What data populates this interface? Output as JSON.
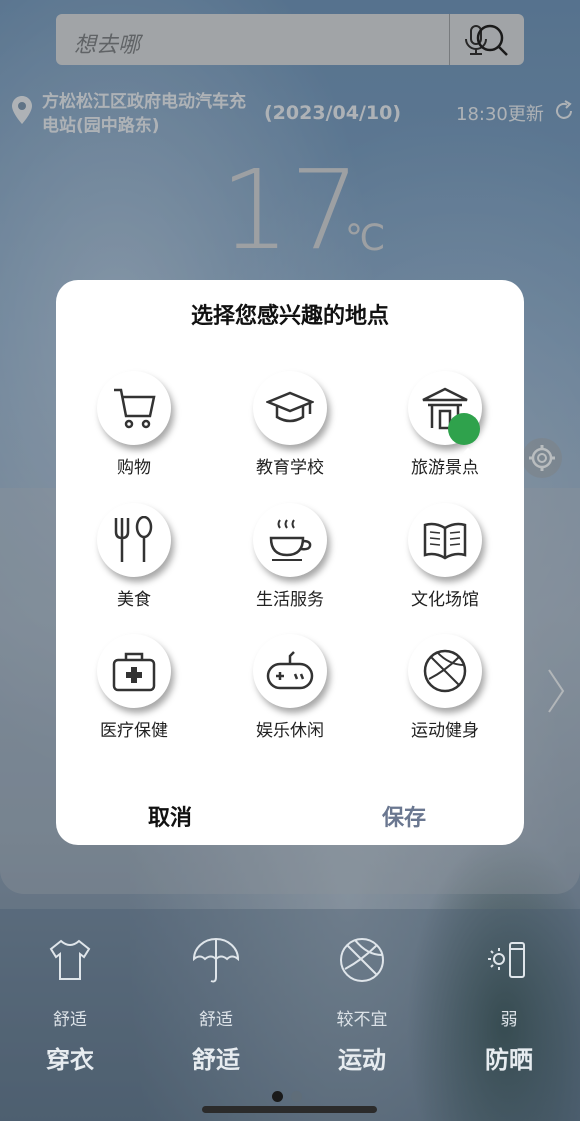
{
  "search": {
    "placeholder": "想去哪"
  },
  "location": {
    "name": "方松松江区政府电动汽车充电站(园中路东)",
    "date": "(2023/04/10)",
    "updated": "18:30更新"
  },
  "weather": {
    "temperature": "17",
    "unit": "℃"
  },
  "modal": {
    "title": "选择您感兴趣的地点",
    "options": [
      {
        "label": "购物",
        "icon": "shopping-cart-icon",
        "selected": false
      },
      {
        "label": "教育学校",
        "icon": "graduation-cap-icon",
        "selected": false
      },
      {
        "label": "旅游景点",
        "icon": "pavilion-icon",
        "selected": true
      },
      {
        "label": "美食",
        "icon": "fork-spoon-icon",
        "selected": false
      },
      {
        "label": "生活服务",
        "icon": "coffee-cup-icon",
        "selected": false
      },
      {
        "label": "文化场馆",
        "icon": "open-book-icon",
        "selected": false
      },
      {
        "label": "医疗保健",
        "icon": "medical-kit-icon",
        "selected": false
      },
      {
        "label": "娱乐休闲",
        "icon": "gamepad-icon",
        "selected": false
      },
      {
        "label": "运动健身",
        "icon": "ball-icon",
        "selected": false
      }
    ],
    "cancel_label": "取消",
    "save_label": "保存"
  },
  "indices": [
    {
      "level": "舒适",
      "label": "穿衣",
      "icon": "tshirt-icon"
    },
    {
      "level": "舒适",
      "label": "舒适",
      "icon": "umbrella-icon"
    },
    {
      "level": "较不宜",
      "label": "运动",
      "icon": "ball-icon"
    },
    {
      "level": "弱",
      "label": "防晒",
      "icon": "sunscreen-icon"
    }
  ],
  "colors": {
    "accent_save": "#6a7790",
    "check_green": "#2fa24c",
    "modal_bg": "#ffffff"
  }
}
